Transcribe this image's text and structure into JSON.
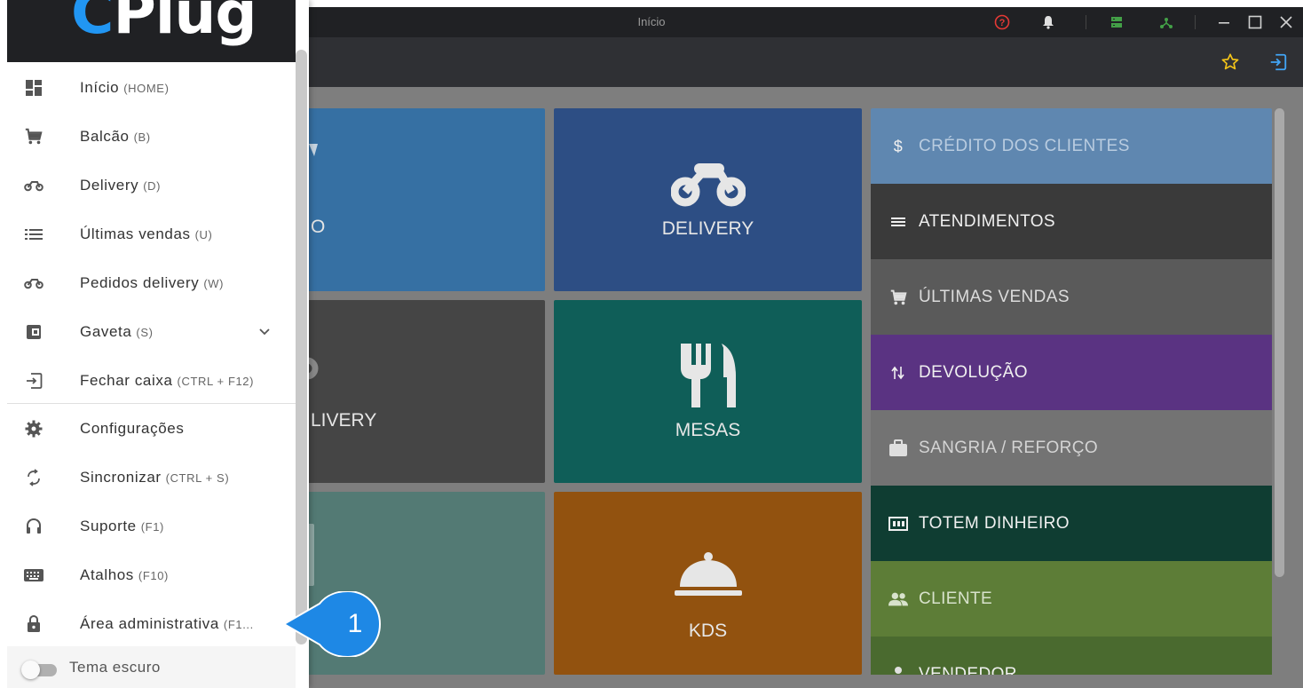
{
  "window": {
    "title": "Início"
  },
  "tiles": [
    {
      "label": "O"
    },
    {
      "label": "DELIVERY"
    },
    {
      "label": "LIVERY"
    },
    {
      "label": "MESAS"
    },
    {
      "label": ""
    },
    {
      "label": "KDS"
    }
  ],
  "side_menu": [
    {
      "label": "CRÉDITO DOS CLIENTES",
      "icon": "dollar-icon",
      "color": "#5f87b0"
    },
    {
      "label": "ATENDIMENTOS",
      "icon": "list-icon",
      "color": "#3a3a3a"
    },
    {
      "label": "ÚLTIMAS VENDAS",
      "icon": "cart-icon",
      "color": "#5a5a5a"
    },
    {
      "label": "DEVOLUÇÃO",
      "icon": "swap-icon",
      "color": "#5a3382"
    },
    {
      "label": "SANGRIA / REFORÇO",
      "icon": "briefcase-icon",
      "color": "#737373"
    },
    {
      "label": "TOTEM DINHEIRO",
      "icon": "cash-icon",
      "color": "#0f3d32"
    },
    {
      "label": "CLIENTE",
      "icon": "people-icon",
      "color": "#5d7d37"
    },
    {
      "label": "VENDEDOR",
      "icon": "person-icon",
      "color": "#4a6a2f"
    }
  ],
  "drawer": {
    "logo_c": "C",
    "logo_rest": "Plug",
    "items": [
      {
        "label": "Início",
        "shortcut": "(HOME)",
        "icon": "dashboard-icon"
      },
      {
        "label": "Balcão",
        "shortcut": "(B)",
        "icon": "cart-icon"
      },
      {
        "label": "Delivery",
        "shortcut": "(D)",
        "icon": "motorcycle-icon"
      },
      {
        "label": "Últimas vendas",
        "shortcut": "(U)",
        "icon": "list-icon"
      },
      {
        "label": "Pedidos delivery",
        "shortcut": "(W)",
        "icon": "motorcycle-icon"
      },
      {
        "label": "Gaveta",
        "shortcut": "(S)",
        "icon": "wallet-icon"
      },
      {
        "label": "Fechar caixa",
        "shortcut": "(CTRL + F12)",
        "icon": "exit-icon"
      },
      {
        "label": "Configurações",
        "shortcut": "",
        "icon": "gear-icon"
      },
      {
        "label": "Sincronizar",
        "shortcut": "(CTRL + S)",
        "icon": "sync-icon"
      },
      {
        "label": "Suporte",
        "shortcut": "(F1)",
        "icon": "headset-icon"
      },
      {
        "label": "Atalhos",
        "shortcut": "(F10)",
        "icon": "keyboard-icon"
      },
      {
        "label": "Área administrativa",
        "shortcut": "(F1...",
        "icon": "lock-icon"
      }
    ],
    "dark_theme_label": "Tema escuro",
    "dark_theme_enabled": false
  },
  "callout": {
    "number": "1",
    "color": "#1e88e5"
  }
}
